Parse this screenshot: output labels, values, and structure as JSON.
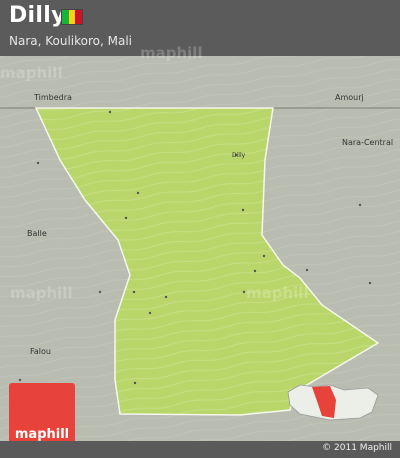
{
  "header": {
    "title": "Dilly",
    "subtitle": "Nara, Koulikoro, Mali",
    "flag_colors": [
      "#14b53a",
      "#fcd116",
      "#ce1126"
    ]
  },
  "map": {
    "region_fill": "#b9d66a",
    "background": "#b9bcb0",
    "places": {
      "timbedra": "Timbedra",
      "amourj": "Amourj",
      "nara_central": "Nara-Central",
      "balle": "Balle",
      "falou": "Falou",
      "dilly": "Dilly"
    },
    "watermarks": [
      "maphill",
      "maphill",
      "maphill",
      "maphill"
    ]
  },
  "logo": {
    "text": "maphill",
    "color": "#e8433a"
  },
  "footer": {
    "copyright": "© 2011 Maphill"
  }
}
